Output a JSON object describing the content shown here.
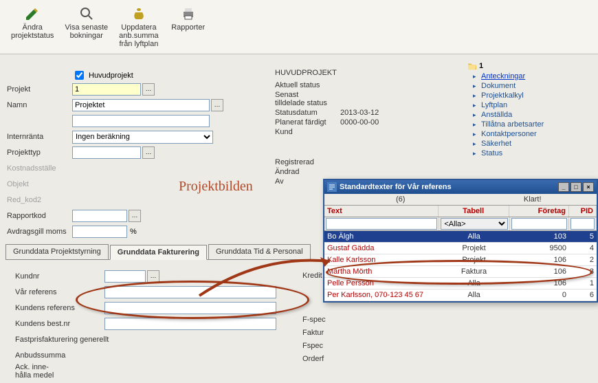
{
  "toolbar": {
    "edit_status": "Ändra\nprojektstatus",
    "view_bookings": "Visa senaste\nbokningar",
    "update_sum": "Uppdatera\nanb.summa\nfrån lyftplan",
    "reports": "Rapporter"
  },
  "main_checkbox_label": "Huvudprojekt",
  "labels": {
    "projekt": "Projekt",
    "namn": "Namn",
    "internranta": "Internränta",
    "projekttyp": "Projekttyp",
    "kostnadsstalle": "Kostnadsställe",
    "objekt": "Objekt",
    "red_kod2": "Red_kod2",
    "rapportkod": "Rapportkod",
    "avdr_moms": "Avdragsgill moms",
    "pct": "%"
  },
  "values": {
    "projekt": "1",
    "namn": "Projektet",
    "internranta": "Ingen beräkning",
    "avdr_moms": ""
  },
  "status": {
    "heading": "HUVUDPROJEKT",
    "aktuell_label": "Aktuell status",
    "senast_label": "Senast\ntilldelade status",
    "statusdatum_label": "Statusdatum",
    "statusdatum": "2013-03-12",
    "planerat_label": "Planerat färdigt",
    "planerat": "0000-00-00",
    "kund_label": "Kund",
    "registrerad_label": "Registrerad",
    "andrad_label": "Ändrad",
    "av_label": "Av"
  },
  "tree": {
    "root": "1",
    "items": [
      {
        "label": "Anteckningar",
        "active": true
      },
      {
        "label": "Dokument"
      },
      {
        "label": "Projektkalkyl"
      },
      {
        "label": "Lyftplan"
      },
      {
        "label": "Anställda"
      },
      {
        "label": "Tillåtna arbetsarter"
      },
      {
        "label": "Kontaktpersoner"
      },
      {
        "label": "Säkerhet"
      },
      {
        "label": "Status"
      }
    ]
  },
  "annotation": "Projektbilden",
  "tabs": {
    "t1": "Grunddata Projektstyrning",
    "t2": "Grunddata Fakturering",
    "t3": "Grunddata Tid & Personal"
  },
  "tab_body": {
    "kundnr": "Kundnr",
    "var_referens": "Vår referens",
    "kund_ref": "Kundens referens",
    "kund_best": "Kundens best.nr",
    "fastpris": "Fastprisfakturering generellt",
    "anbud": "Anbudssumma",
    "ack": "Ack. inne-\nhålla medel"
  },
  "right_side_labels": {
    "kredit": "Kredit",
    "fspec1": "F-spec",
    "faktur": "Faktur",
    "fspec2": "Fspec",
    "orderf": "Orderf"
  },
  "dialog": {
    "title": "Standardtexter för Vår referens",
    "count": "(6)",
    "done": "Klart!",
    "col_text": "Text",
    "col_tabell": "Tabell",
    "col_foretag": "Företag",
    "col_pid": "PID",
    "filter_tabell": "<Alla>",
    "rows": [
      {
        "text": "Bo Älgh",
        "tabell": "Alla",
        "foretag": "103",
        "pid": "5",
        "sel": true
      },
      {
        "text": "Gustaf Gädda",
        "tabell": "Projekt",
        "foretag": "9500",
        "pid": "4"
      },
      {
        "text": "Kalle Karlsson",
        "tabell": "Projekt",
        "foretag": "106",
        "pid": "2"
      },
      {
        "text": "Märtha Mörth",
        "tabell": "Faktura",
        "foretag": "106",
        "pid": "3"
      },
      {
        "text": "Pelle Persson",
        "tabell": "Alla",
        "foretag": "106",
        "pid": "1"
      },
      {
        "text": "Per Karlsson, 070-123 45 67",
        "tabell": "Alla",
        "foretag": "0",
        "pid": "6"
      }
    ]
  }
}
